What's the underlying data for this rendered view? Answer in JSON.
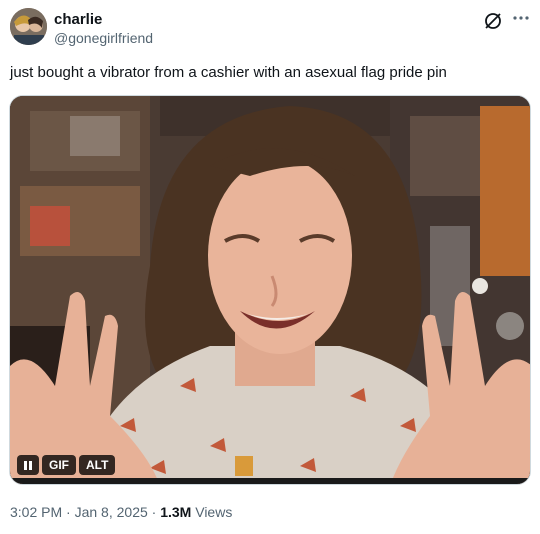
{
  "author": {
    "display_name": "charlie",
    "handle": "@gonegirlfriend"
  },
  "tweet": {
    "text": "just bought a vibrator from a cashier with an asexual flag pride pin"
  },
  "media": {
    "type": "gif",
    "controls": {
      "pause_label": "pause",
      "gif_label": "GIF",
      "alt_label": "ALT"
    }
  },
  "meta": {
    "time": "3:02 PM",
    "separator": "·",
    "date": "Jan 8, 2025",
    "views_count": "1.3M",
    "views_label": "Views"
  },
  "icons": {
    "grok": "grok-icon",
    "more": "more-icon",
    "pause": "pause-icon"
  }
}
